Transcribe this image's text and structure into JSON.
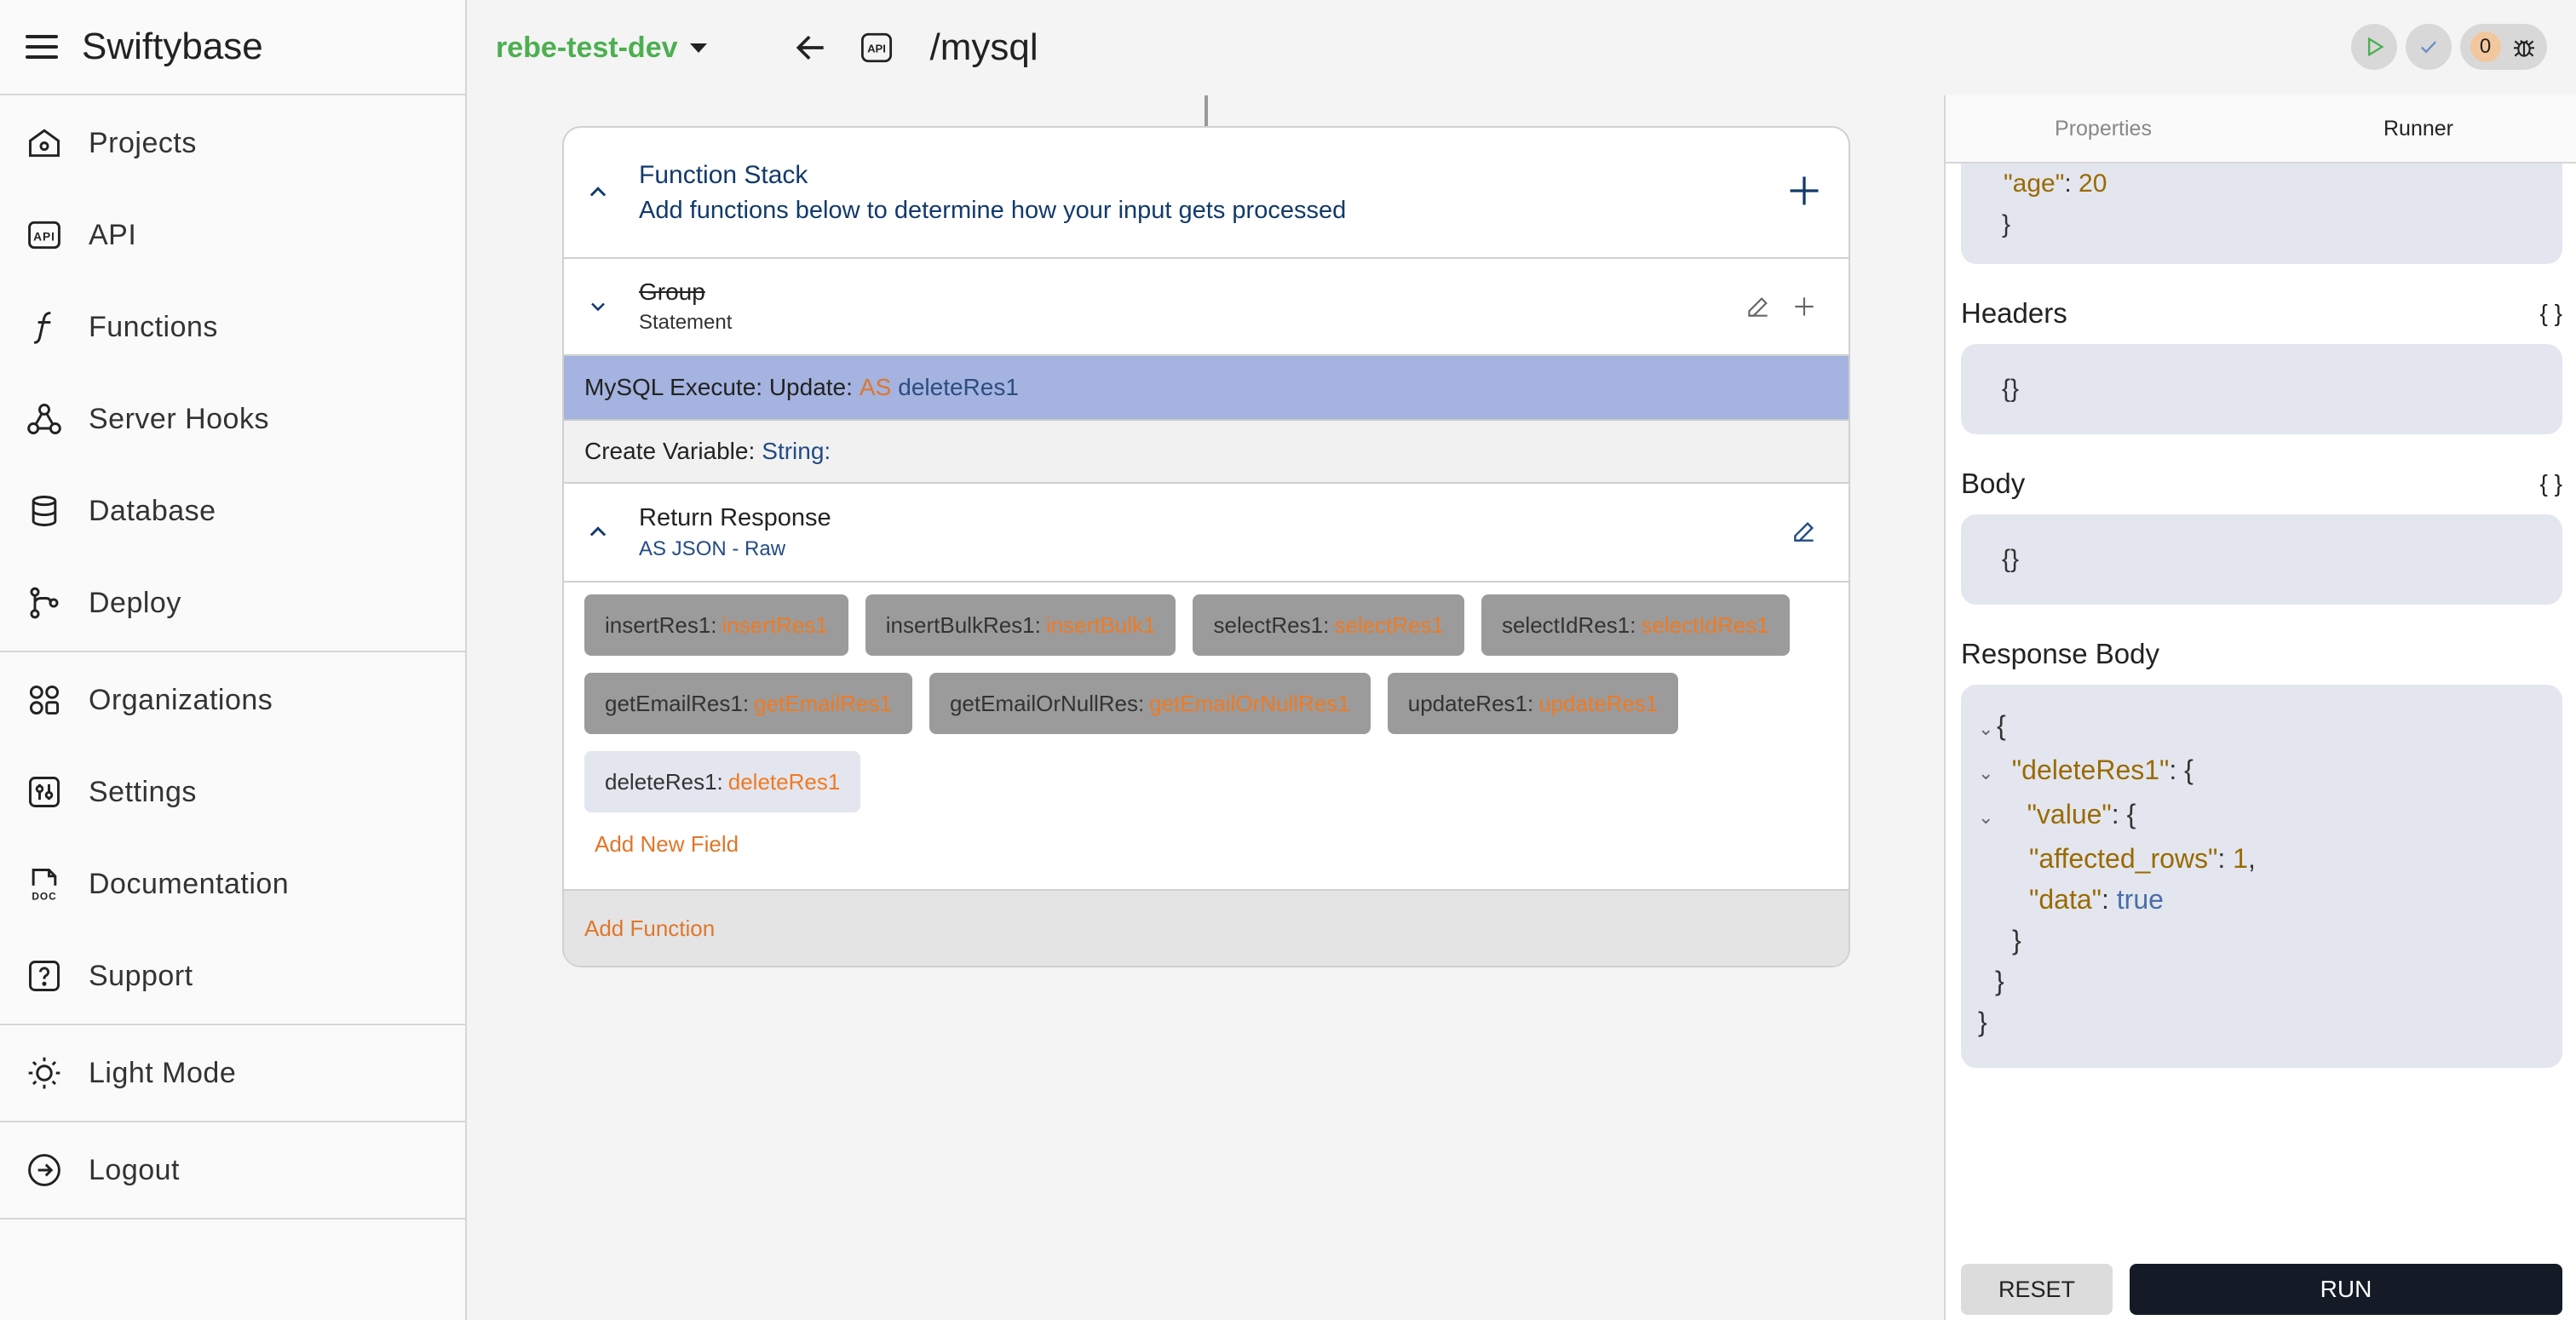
{
  "app": {
    "title": "Swiftybase"
  },
  "sidebar": {
    "items": [
      {
        "label": "Projects",
        "icon": "home-icon"
      },
      {
        "label": "API",
        "icon": "api-icon"
      },
      {
        "label": "Functions",
        "icon": "function-icon"
      },
      {
        "label": "Server Hooks",
        "icon": "webhook-icon"
      },
      {
        "label": "Database",
        "icon": "database-icon"
      },
      {
        "label": "Deploy",
        "icon": "branch-icon"
      },
      {
        "label": "Organizations",
        "icon": "organizations-icon"
      },
      {
        "label": "Settings",
        "icon": "settings-icon"
      },
      {
        "label": "Documentation",
        "icon": "doc-icon"
      },
      {
        "label": "Support",
        "icon": "help-icon"
      },
      {
        "label": "Light Mode",
        "icon": "sun-icon"
      },
      {
        "label": "Logout",
        "icon": "logout-icon"
      }
    ]
  },
  "topbar": {
    "environment": "rebe-test-dev",
    "path": "/mysql",
    "error_count": "0"
  },
  "stack": {
    "title": "Function Stack",
    "subtitle": "Add functions below to determine how your input gets processed",
    "group": {
      "name": "Group",
      "type": "Statement"
    },
    "mysql": {
      "prefix": "MySQL Execute: Update:",
      "as": "AS",
      "var": "deleteRes1"
    },
    "create_var": {
      "prefix": "Create Variable:",
      "type": "String:"
    },
    "return": {
      "title": "Return Response",
      "subtitle": "AS JSON - Raw"
    },
    "fields": [
      {
        "key": "insertRes1:",
        "value": "insertRes1"
      },
      {
        "key": "insertBulkRes1:",
        "value": "insertBulk1"
      },
      {
        "key": "selectRes1:",
        "value": "selectRes1"
      },
      {
        "key": "selectIdRes1:",
        "value": "selectIdRes1"
      },
      {
        "key": "getEmailRes1:",
        "value": "getEmailRes1"
      },
      {
        "key": "getEmailOrNullRes:",
        "value": "getEmailOrNullRes1"
      },
      {
        "key": "updateRes1:",
        "value": "updateRes1"
      },
      {
        "key": "deleteRes1:",
        "value": "deleteRes1"
      }
    ],
    "add_field": "Add New Field",
    "add_function": "Add Function"
  },
  "panel": {
    "tabs": [
      "Properties",
      "Runner"
    ],
    "body_tail": {
      "key": "\"age\"",
      "value": "20",
      "close": "}"
    },
    "headers_title": "Headers",
    "headers_value": "{}",
    "body_title": "Body",
    "body_value": "{}",
    "braces_icon": "{ }",
    "response_title": "Response Body",
    "response": {
      "l1": "{",
      "k2": "\"deleteRes1\"",
      "o2": ": {",
      "k3": "\"value\"",
      "o3": ": {",
      "k4": "\"affected_rows\"",
      "v4": "1",
      "k5": "\"data\"",
      "v5": "true",
      "c6": "}",
      "c7": "}",
      "c8": "}"
    },
    "reset": "RESET",
    "run": "RUN"
  }
}
